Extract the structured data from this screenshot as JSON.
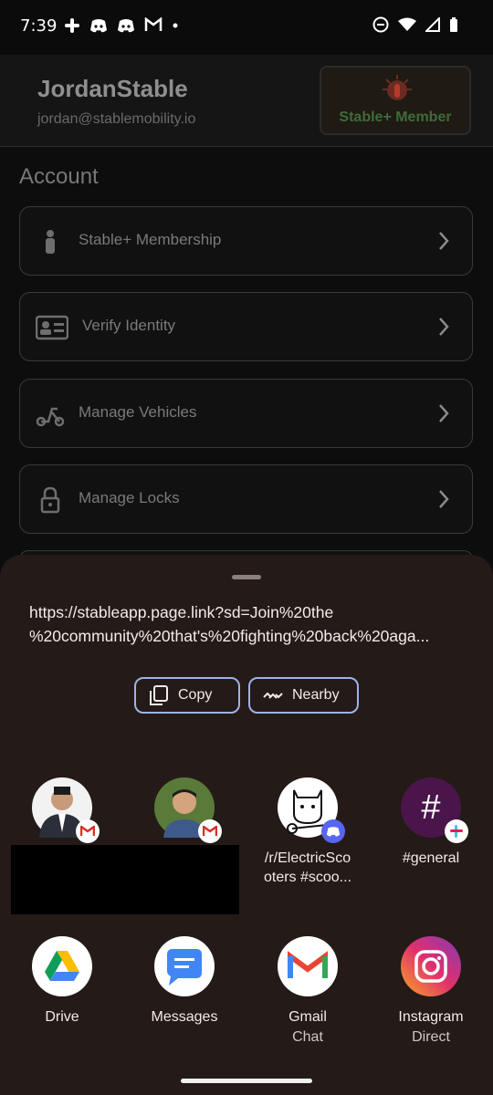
{
  "status": {
    "time": "7:39",
    "left_icons": [
      "slack-icon",
      "discord-icon",
      "discord-icon",
      "gmail-icon",
      "dot-icon"
    ],
    "right_icons": [
      "do-not-disturb-icon",
      "wifi-icon",
      "signal-icon",
      "battery-icon"
    ]
  },
  "header": {
    "name": "JordanStable",
    "email": "jordan@stablemobility.io",
    "badge_label": "Stable+ Member"
  },
  "account": {
    "title": "Account",
    "items": [
      {
        "label": "Stable+ Membership",
        "icon": "person-icon"
      },
      {
        "label": "Verify Identity",
        "icon": "id-card-icon"
      },
      {
        "label": "Manage Vehicles",
        "icon": "scooter-icon"
      },
      {
        "label": "Manage Locks",
        "icon": "lock-icon"
      }
    ]
  },
  "share_sheet": {
    "url_line1": "https://stableapp.page.link?sd=Join%20the",
    "url_line2": "%20community%20that's%20fighting%20back%20aga...",
    "copy_label": "Copy",
    "nearby_label": "Nearby",
    "direct_targets": [
      {
        "label": "",
        "badge": "gmail-icon"
      },
      {
        "label": "",
        "badge": "gmail-icon"
      },
      {
        "label": "/r/ElectricSco\noters #scoo...",
        "badge": "discord-icon"
      },
      {
        "label": "#general",
        "badge": "slack-icon"
      }
    ],
    "apps": [
      {
        "label": "Drive",
        "sub": ""
      },
      {
        "label": "Messages",
        "sub": ""
      },
      {
        "label": "Gmail",
        "sub": "Chat"
      },
      {
        "label": "Instagram",
        "sub": "Direct"
      }
    ]
  }
}
